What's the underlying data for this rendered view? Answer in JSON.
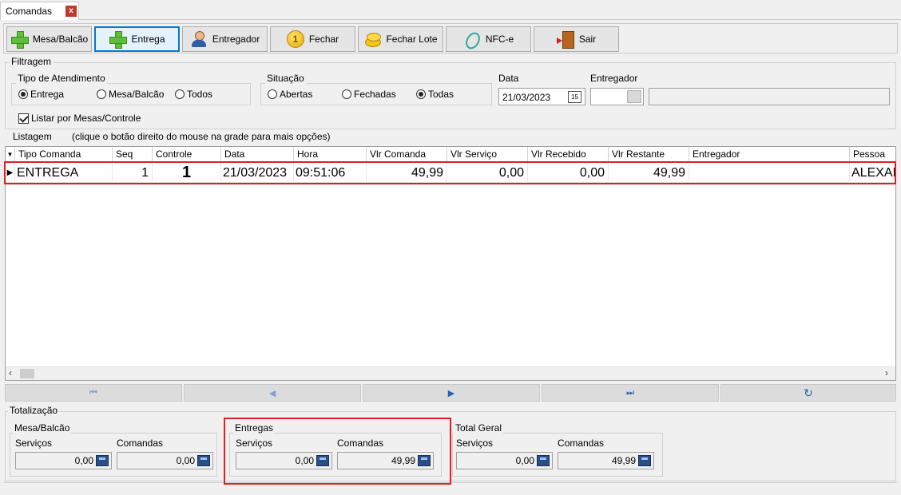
{
  "tab": {
    "title": "Comandas",
    "close": "x"
  },
  "toolbar": {
    "mesa_balcao": "Mesa/Balcão",
    "entrega": "Entrega",
    "entregador": "Entregador",
    "fechar": "Fechar",
    "fechar_lote": "Fechar Lote",
    "nfce": "NFC-e",
    "sair": "Sair"
  },
  "filtragem": {
    "title": "Filtragem",
    "tipo_atendimento": {
      "label": "Tipo de Atendimento",
      "options": [
        "Entrega",
        "Mesa/Balcão",
        "Todos"
      ],
      "selected": "Entrega"
    },
    "situacao": {
      "label": "Situação",
      "options": [
        "Abertas",
        "Fechadas",
        "Todas"
      ],
      "selected": "Todas"
    },
    "data": {
      "label": "Data",
      "value": "21/03/2023",
      "picker_glyph": "15"
    },
    "entregador": {
      "label": "Entregador",
      "code": "",
      "name": ""
    },
    "listar_por_mesas": {
      "label": "Listar por Mesas/Controle",
      "checked": true
    }
  },
  "listagem": {
    "title": "Listagem",
    "hint": "(clique o botão direito do mouse na grade para mais opções)",
    "columns": [
      "Tipo Comanda",
      "Seq",
      "Controle",
      "Data",
      "Hora",
      "Vlr Comanda",
      "Vlr Serviço",
      "Vlr Recebido",
      "Vlr Restante",
      "Entregador",
      "Pessoa"
    ],
    "rows": [
      {
        "tipo_comanda": "ENTREGA",
        "seq": "1",
        "controle": "1",
        "data": "21/03/2023",
        "hora": "09:51:06",
        "vlr_comanda": "49,99",
        "vlr_servico": "0,00",
        "vlr_recebido": "0,00",
        "vlr_restante": "49,99",
        "entregador": "",
        "pessoa": "ALEXAN"
      }
    ]
  },
  "navigator": {
    "buttons": [
      "first",
      "prior",
      "next",
      "last",
      "refresh"
    ]
  },
  "totalizacao": {
    "title": "Totalização",
    "mesa_balcao": {
      "title": "Mesa/Balcão",
      "servicos_label": "Serviços",
      "comandas_label": "Comandas",
      "servicos": "0,00",
      "comandas": "0,00"
    },
    "entregas": {
      "title": "Entregas",
      "servicos_label": "Serviços",
      "comandas_label": "Comandas",
      "servicos": "0,00",
      "comandas": "49,99"
    },
    "total_geral": {
      "title": "Total Geral",
      "servicos_label": "Serviços",
      "comandas_label": "Comandas",
      "servicos": "0,00",
      "comandas": "49,99"
    }
  },
  "colors": {
    "highlight": "#e02020",
    "accent": "#0078d7"
  }
}
